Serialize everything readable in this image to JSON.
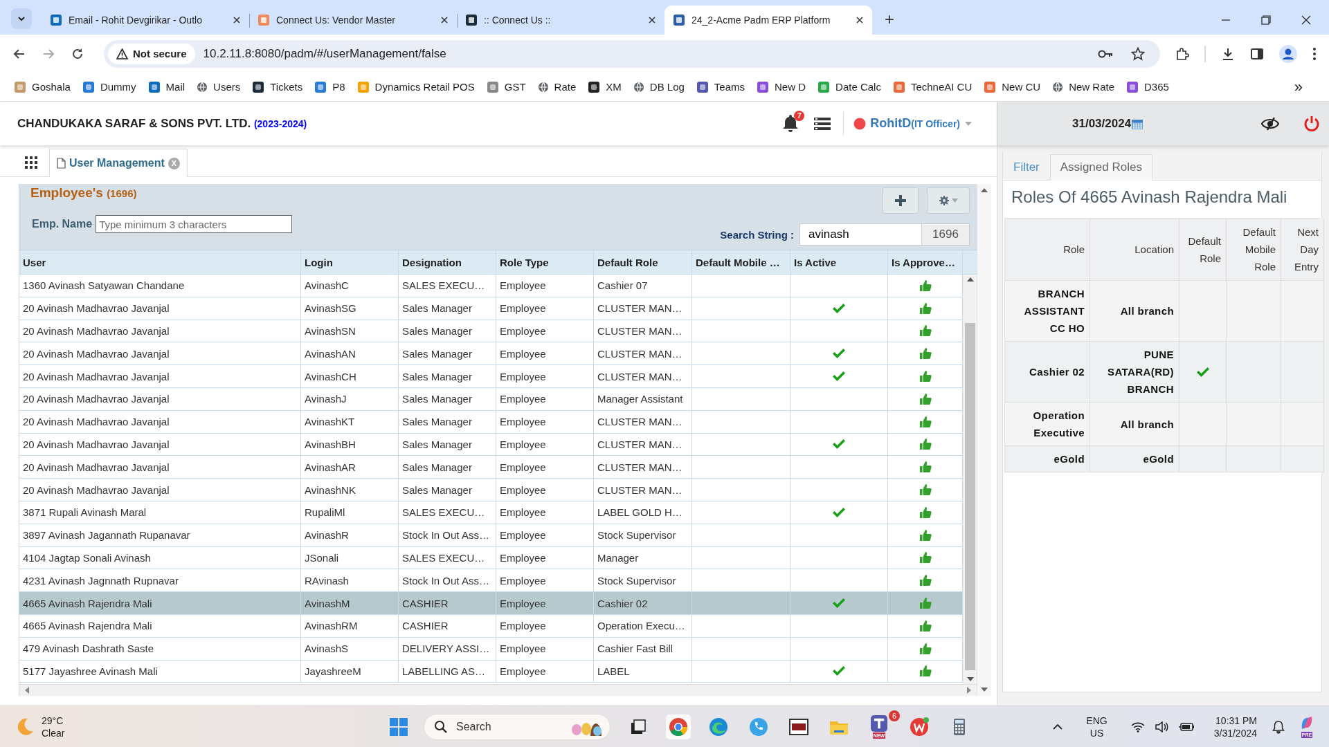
{
  "browser": {
    "tabs": [
      {
        "title": "Email - Rohit Devgirikar - Outlo",
        "selected": false
      },
      {
        "title": "Connect Us: Vendor Master",
        "selected": false
      },
      {
        "title": ":: Connect Us ::",
        "selected": false
      },
      {
        "title": "24_2-Acme Padm ERP Platform",
        "selected": true
      }
    ],
    "new_tab": "+",
    "security": "Not secure",
    "url": "10.2.11.8:8080/padm/#/userManagement/false",
    "bookmarks": [
      "Goshala",
      "Dummy",
      "Mail",
      "Users",
      "Tickets",
      "P8",
      "Dynamics Retail POS",
      "GST",
      "Rate",
      "XM",
      "DB Log",
      "Teams",
      "New D",
      "Date Calc",
      "TechneAI CU",
      "New CU",
      "New Rate",
      "D365"
    ],
    "more": "»"
  },
  "app": {
    "company": "CHANDUKAKA SARAF & SONS PVT. LTD.",
    "year": "(2023-2024)",
    "notifications": "7",
    "user": "RohitD",
    "role": "(IT Officer)",
    "date": "31/03/2024",
    "module_tabs": [
      {
        "label": "User Management",
        "selected": true
      }
    ],
    "close_tab": "X"
  },
  "employees": {
    "title": "Employee's",
    "count": "(1696)",
    "emp_name": {
      "label": "Emp. Name",
      "placeholder": "Type minimum 3 characters"
    },
    "search": {
      "label": "Search String :",
      "value": "avinash",
      "count": "1696"
    },
    "columns": [
      "User",
      "Login",
      "Designation",
      "Role Type",
      "Default Role",
      "Default Mobile …",
      "Is Active",
      "Is Approve…"
    ],
    "rows": [
      {
        "user": "1360 Avinash Satyawan Chandane",
        "login": "AvinashC",
        "designation": "SALES EXECU…",
        "role_type": "Employee",
        "default_role": "Cashier 07",
        "active": false,
        "approved": true,
        "selected": false
      },
      {
        "user": "20 Avinash Madhavrao Javanjal",
        "login": "AvinashSG",
        "designation": "Sales Manager",
        "role_type": "Employee",
        "default_role": "CLUSTER MAN…",
        "active": true,
        "approved": true,
        "selected": false
      },
      {
        "user": "20 Avinash Madhavrao Javanjal",
        "login": "AvinashSN",
        "designation": "Sales Manager",
        "role_type": "Employee",
        "default_role": "CLUSTER MAN…",
        "active": false,
        "approved": true,
        "selected": false
      },
      {
        "user": "20 Avinash Madhavrao Javanjal",
        "login": "AvinashAN",
        "designation": "Sales Manager",
        "role_type": "Employee",
        "default_role": "CLUSTER MAN…",
        "active": true,
        "approved": true,
        "selected": false
      },
      {
        "user": "20 Avinash Madhavrao Javanjal",
        "login": "AvinashCH",
        "designation": "Sales Manager",
        "role_type": "Employee",
        "default_role": "CLUSTER MAN…",
        "active": true,
        "approved": true,
        "selected": false
      },
      {
        "user": "20 Avinash Madhavrao Javanjal",
        "login": "AvinashJ",
        "designation": "Sales Manager",
        "role_type": "Employee",
        "default_role": "Manager Assistant",
        "active": false,
        "approved": true,
        "selected": false
      },
      {
        "user": "20 Avinash Madhavrao Javanjal",
        "login": "AvinashKT",
        "designation": "Sales Manager",
        "role_type": "Employee",
        "default_role": "CLUSTER MAN…",
        "active": false,
        "approved": true,
        "selected": false
      },
      {
        "user": "20 Avinash Madhavrao Javanjal",
        "login": "AvinashBH",
        "designation": "Sales Manager",
        "role_type": "Employee",
        "default_role": "CLUSTER MAN…",
        "active": true,
        "approved": true,
        "selected": false
      },
      {
        "user": "20 Avinash Madhavrao Javanjal",
        "login": "AvinashAR",
        "designation": "Sales Manager",
        "role_type": "Employee",
        "default_role": "CLUSTER MAN…",
        "active": false,
        "approved": true,
        "selected": false
      },
      {
        "user": "20 Avinash Madhavrao Javanjal",
        "login": "AvinashNK",
        "designation": "Sales Manager",
        "role_type": "Employee",
        "default_role": "CLUSTER MAN…",
        "active": false,
        "approved": true,
        "selected": false
      },
      {
        "user": "3871 Rupali Avinash Maral",
        "login": "RupaliMl",
        "designation": "SALES EXECU…",
        "role_type": "Employee",
        "default_role": "LABEL GOLD H…",
        "active": true,
        "approved": true,
        "selected": false
      },
      {
        "user": "3897 Avinash Jagannath Rupanavar",
        "login": "AvinashR",
        "designation": "Stock In Out Ass…",
        "role_type": "Employee",
        "default_role": "Stock Supervisor",
        "active": false,
        "approved": true,
        "selected": false
      },
      {
        "user": "4104 Jagtap Sonali Avinash",
        "login": "JSonali",
        "designation": "SALES EXECU…",
        "role_type": "Employee",
        "default_role": "Manager",
        "active": false,
        "approved": true,
        "selected": false
      },
      {
        "user": "4231 Avinash Jagnnath Rupnavar",
        "login": "RAvinash",
        "designation": "Stock In Out Ass…",
        "role_type": "Employee",
        "default_role": "Stock Supervisor",
        "active": false,
        "approved": true,
        "selected": false
      },
      {
        "user": "4665 Avinash Rajendra Mali",
        "login": "AvinashM",
        "designation": "CASHIER",
        "role_type": "Employee",
        "default_role": "Cashier 02",
        "active": true,
        "approved": true,
        "selected": true
      },
      {
        "user": "4665 Avinash Rajendra Mali",
        "login": "AvinashRM",
        "designation": "CASHIER",
        "role_type": "Employee",
        "default_role": "Operation Execu…",
        "active": false,
        "approved": true,
        "selected": false
      },
      {
        "user": "479 Avinash Dashrath Saste",
        "login": "AvinashS",
        "designation": "DELIVERY ASSI…",
        "role_type": "Employee",
        "default_role": "Cashier Fast Bill",
        "active": false,
        "approved": true,
        "selected": false
      },
      {
        "user": "5177 Jayashree Avinash Mali",
        "login": "JayashreeM",
        "designation": "LABELLING AS…",
        "role_type": "Employee",
        "default_role": "LABEL",
        "active": true,
        "approved": true,
        "selected": false
      }
    ]
  },
  "roles": {
    "tabs": [
      {
        "label": "Filter",
        "selected": false
      },
      {
        "label": "Assigned Roles",
        "selected": true
      }
    ],
    "title": "Roles Of 4665 Avinash Rajendra Mali",
    "columns": [
      "Role",
      "Location",
      "Default Role",
      "Default Mobile Role",
      "Next Day Entry"
    ],
    "rows": [
      {
        "role": "BRANCH ASSISTANT CC HO",
        "location": "All branch",
        "default_role": false
      },
      {
        "role": "Cashier 02",
        "location": "PUNE SATARA(RD) BRANCH",
        "default_role": true
      },
      {
        "role": "Operation Executive",
        "location": "All branch",
        "default_role": false
      },
      {
        "role": "eGold",
        "location": "eGold",
        "default_role": false
      }
    ]
  },
  "taskbar": {
    "temperature": "29°C",
    "weather": "Clear",
    "search": "Search",
    "teams_badge": "6",
    "teams_tag": "NEW",
    "copilot_tag": "PRE",
    "language": "ENG",
    "region": "US",
    "time": "10:31 PM",
    "date": "3/31/2024"
  }
}
